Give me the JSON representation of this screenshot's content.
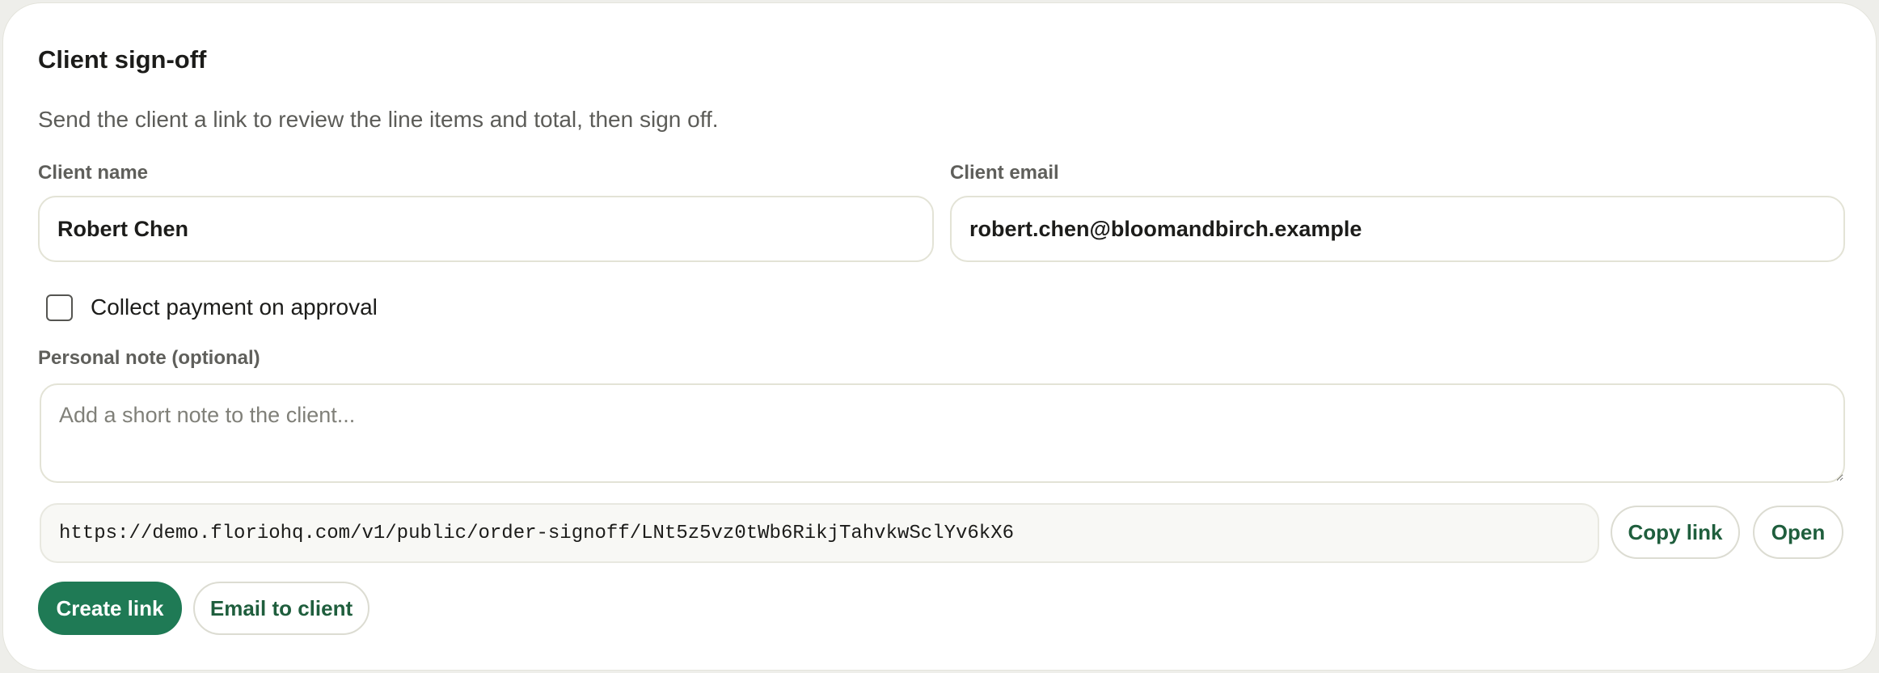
{
  "card": {
    "title": "Client sign-off",
    "description": "Send the client a link to review the line items and total, then sign off."
  },
  "client_name": {
    "label": "Client name",
    "value": "Robert Chen"
  },
  "client_email": {
    "label": "Client email",
    "value": "robert.chen@bloomandbirch.example"
  },
  "collect_payment": {
    "label": "Collect payment on approval",
    "checked": false
  },
  "personal_note": {
    "label": "Personal note (optional)",
    "placeholder": "Add a short note to the client..."
  },
  "signoff_link": {
    "url": "https://demo.floriohq.com/v1/public/order-signoff/LNt5z5vz0tWb6RikjTahvkwSclYv6kX6",
    "copy_label": "Copy link",
    "open_label": "Open"
  },
  "actions": {
    "create_label": "Create link",
    "email_label": "Email to client"
  },
  "colors": {
    "primary": "#1f7a55",
    "primary_text": "#1f5e3d"
  }
}
